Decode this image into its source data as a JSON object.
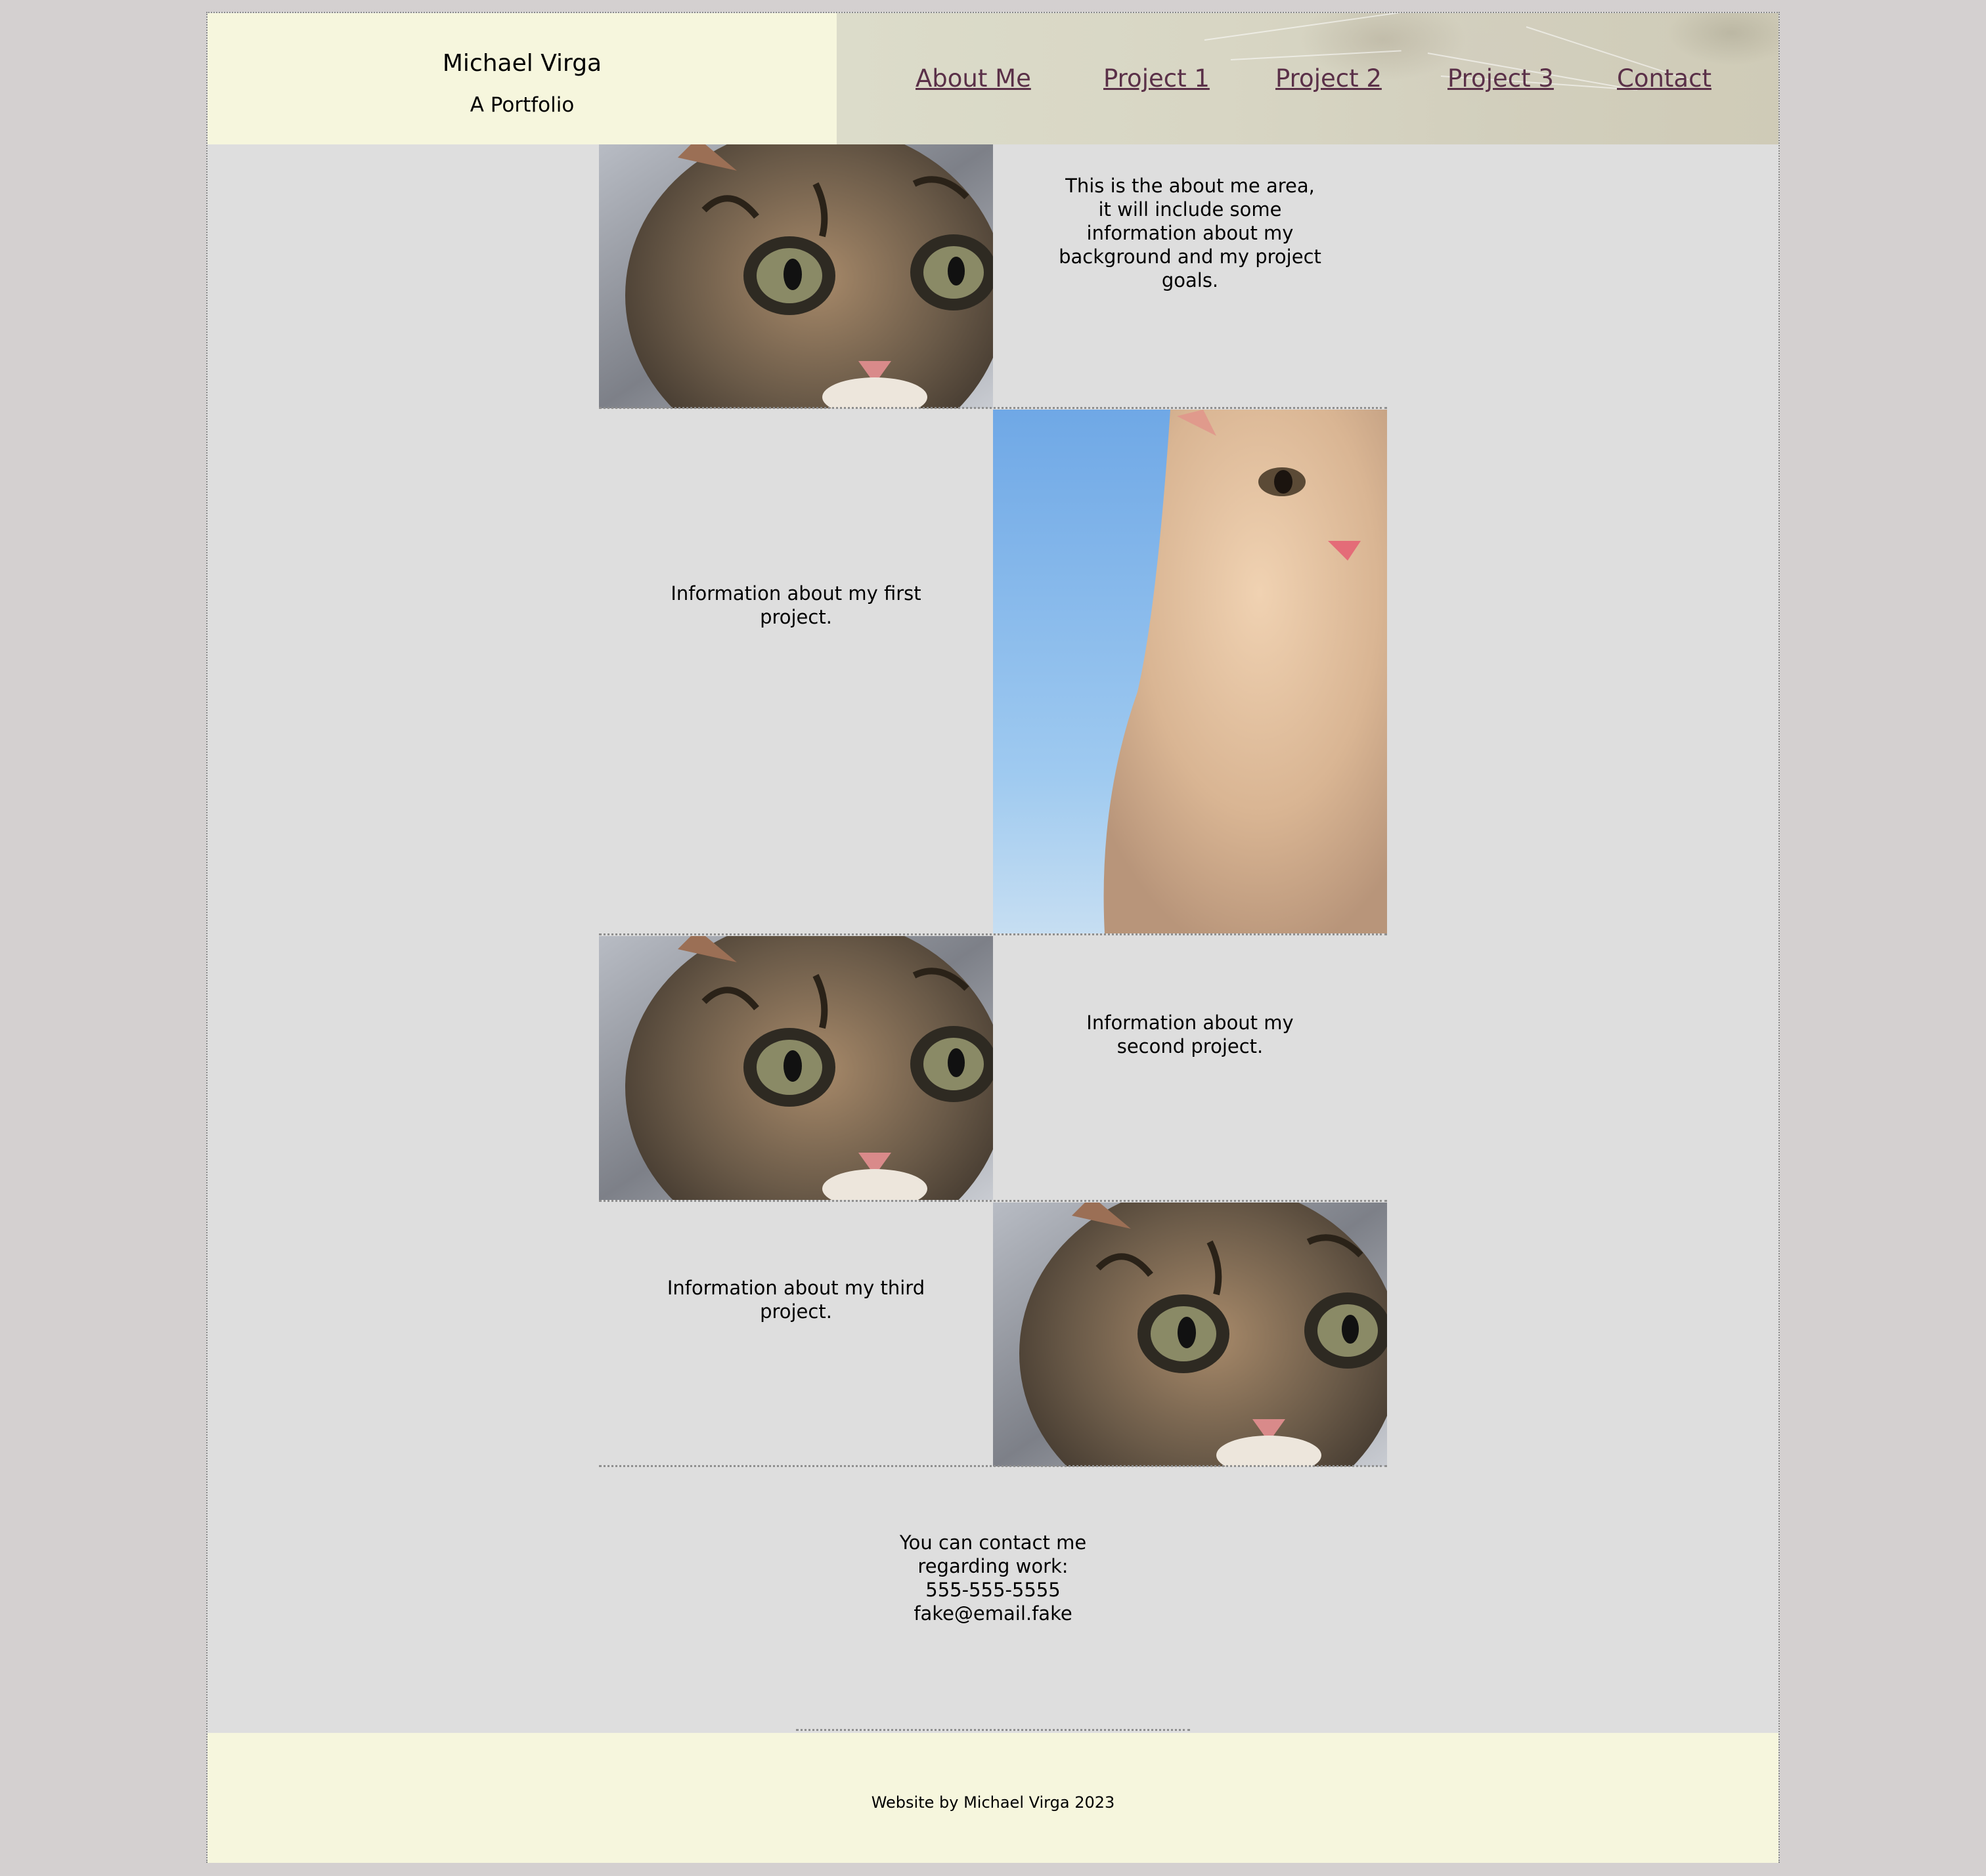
{
  "header": {
    "name": "Michael Virga",
    "tagline": "A Portfolio"
  },
  "nav": {
    "items": [
      "About Me",
      "Project 1",
      "Project 2",
      "Project 3",
      "Contact"
    ]
  },
  "sections": {
    "about": "This is the about me area, it will include some information about my background and my project goals.",
    "project1": "Information about my first project.",
    "project2": "Information about my second project.",
    "project3": "Information about my third project."
  },
  "contact": {
    "intro": "You can contact me regarding work:",
    "phone": "555-555-5555",
    "email": "fake@email.fake"
  },
  "footer": {
    "credit": "Website by Michael Virga 2023"
  },
  "colors": {
    "page_bg": "#d4d0d0",
    "content_bg": "#dedede",
    "accent_band": "#f6f6dd",
    "link": "#5a3048"
  }
}
